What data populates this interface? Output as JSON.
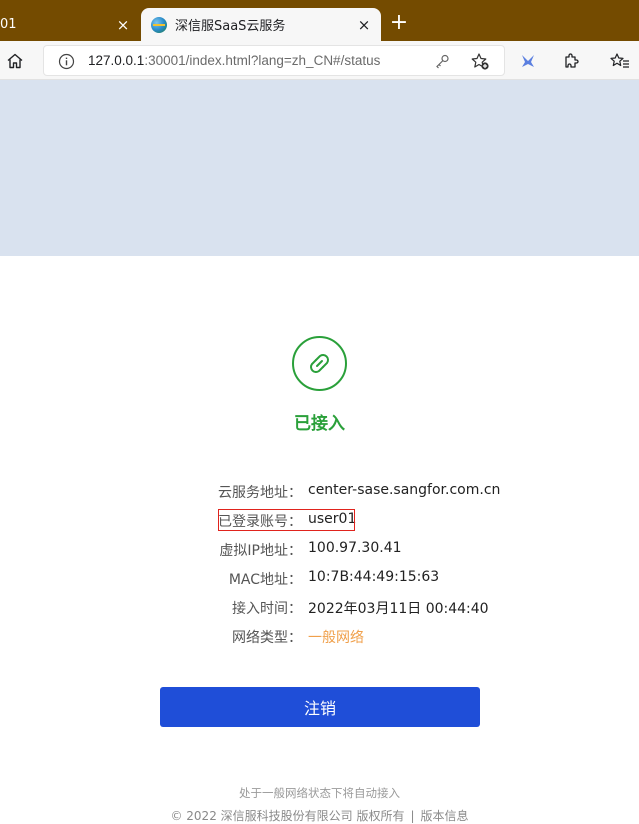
{
  "browser": {
    "tabs": [
      {
        "title": "01",
        "active": false
      },
      {
        "title": "深信服SaaS云服务",
        "active": true
      }
    ],
    "close_glyph": "×",
    "newtab_glyph": "+",
    "url_host": "127.0.0.1",
    "url_rest": ":30001/index.html?lang=zh_CN#/status",
    "icons": [
      "home-icon",
      "info-icon",
      "key-icon",
      "add-favorite-icon",
      "extension-bird-icon",
      "extensions-icon",
      "favorites-icon"
    ]
  },
  "status": {
    "label": "已接入",
    "icon": "link-icon",
    "color": "#2aa03a"
  },
  "info": [
    {
      "label": "云服务地址：",
      "value": "center-sase.sangfor.com.cn"
    },
    {
      "label": "已登录账号：",
      "value": "user01"
    },
    {
      "label": "虚拟IP地址：",
      "value": "100.97.30.41"
    },
    {
      "label": "MAC地址：",
      "value": "10:7B:44:49:15:63"
    },
    {
      "label": "接入时间：",
      "value": "2022年03月11日 00:44:40"
    },
    {
      "label": "网络类型：",
      "value": "一般网络"
    }
  ],
  "logout_label": "注销",
  "footer": {
    "notice": "处于一般网络状态下将自动接入",
    "copyright": "© 2022 深信服科技股份有限公司 版权所有",
    "separator": "|",
    "version_link": "版本信息"
  },
  "colors": {
    "accent": "#1f4ed8",
    "tabstrip": "#744b00",
    "banner": "#d9e2ef",
    "network_type": "#f0a04b",
    "highlight_box": "#e0231d"
  }
}
